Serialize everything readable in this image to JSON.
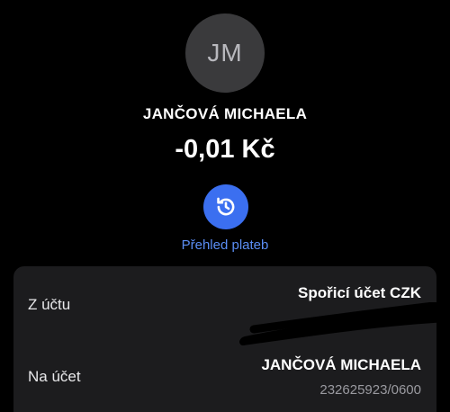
{
  "contact": {
    "initials": "JM",
    "name": "JANČOVÁ MICHAELA"
  },
  "transaction": {
    "amount": "-0,01 Kč"
  },
  "history": {
    "icon": "history-icon",
    "label": "Přehled plateb"
  },
  "details": {
    "from_label": "Z účtu",
    "from_value": "Spořicí účet CZK",
    "to_label": "Na účet",
    "to_name": "JANČOVÁ MICHAELA",
    "to_account": "232625923/0600"
  },
  "colors": {
    "accent": "#3b6ff0",
    "link": "#5b8ef5",
    "card": "#1c1c1e",
    "avatar": "#3a3a3c"
  }
}
